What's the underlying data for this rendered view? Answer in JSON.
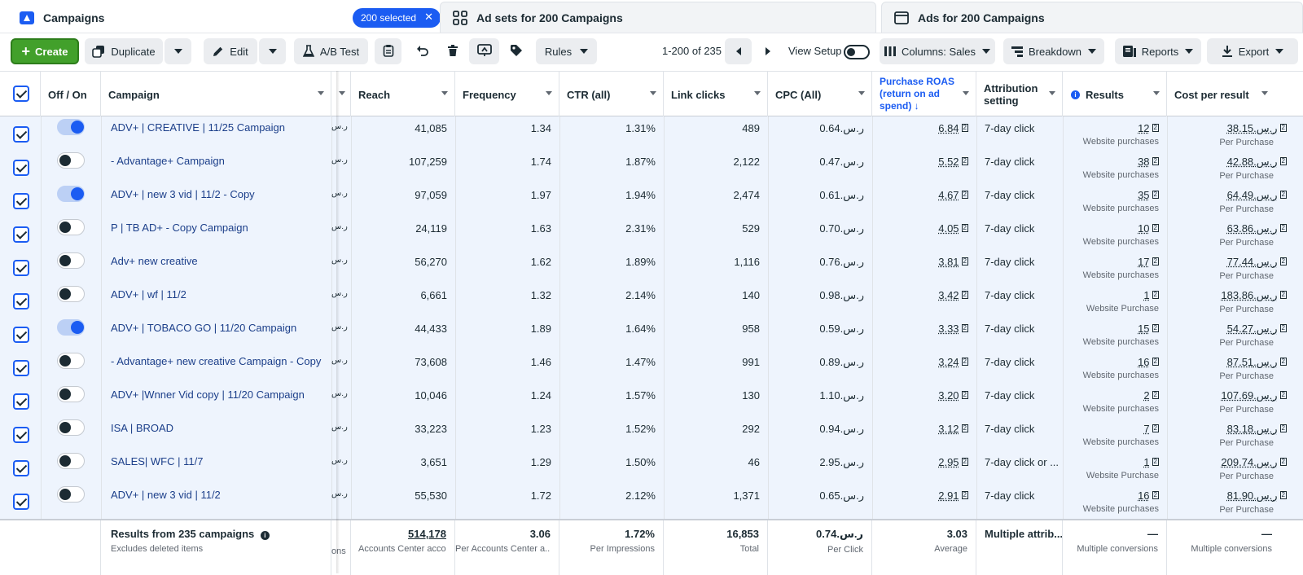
{
  "tabs": {
    "campaigns": {
      "label": "Campaigns",
      "selected_pill": "200 selected"
    },
    "adsets": {
      "label": "Ad sets for 200 Campaigns"
    },
    "ads": {
      "label": "Ads for 200 Campaigns"
    }
  },
  "toolbar": {
    "create": "Create",
    "duplicate": "Duplicate",
    "edit": "Edit",
    "abtest": "A/B Test",
    "rules": "Rules",
    "pager": "1-200 of 235",
    "view_setup": "View Setup",
    "columns": "Columns: Sales",
    "breakdown": "Breakdown",
    "reports": "Reports",
    "export": "Export"
  },
  "columns": {
    "offon": "Off / On",
    "campaign": "Campaign",
    "reach": "Reach",
    "frequency": "Frequency",
    "ctr": "CTR (all)",
    "link_clicks": "Link clicks",
    "cpc": "CPC (All)",
    "roas_1": "Purchase ROAS",
    "roas_2": "(return on ad",
    "roas_3": "spend) ↓",
    "attr_1": "Attribution",
    "attr_2": "setting",
    "results": "Results",
    "cost": "Cost per result"
  },
  "rows": [
    {
      "name": "ADV+ | CREATIVE | 11/25 Campaign",
      "on": true,
      "cur": "ر.س",
      "reach": "41,085",
      "freq": "1.34",
      "ctr": "1.31%",
      "clicks": "489",
      "cpc": "ر.س.0.64",
      "roas": "6.84",
      "attr": "7-day click",
      "results": "12",
      "results_sub": "Website purchases",
      "cost": "ر.س.38.15",
      "cost_sub": "Per Purchase"
    },
    {
      "name": "- Advantage+ Campaign",
      "on": false,
      "cur": "ر.س",
      "reach": "107,259",
      "freq": "1.74",
      "ctr": "1.87%",
      "clicks": "2,122",
      "cpc": "ر.س.0.47",
      "roas": "5.52",
      "attr": "7-day click",
      "results": "38",
      "results_sub": "Website purchases",
      "cost": "ر.س.42.88",
      "cost_sub": "Per Purchase"
    },
    {
      "name": "ADV+ | new 3 vid | 11/2 - Copy",
      "on": true,
      "cur": "ر.س",
      "reach": "97,059",
      "freq": "1.97",
      "ctr": "1.94%",
      "clicks": "2,474",
      "cpc": "ر.س.0.61",
      "roas": "4.67",
      "attr": "7-day click",
      "results": "35",
      "results_sub": "Website purchases",
      "cost": "ر.س.64.49",
      "cost_sub": "Per Purchase"
    },
    {
      "name": "P | TB AD+ - Copy Campaign",
      "on": false,
      "cur": "ر.س",
      "reach": "24,119",
      "freq": "1.63",
      "ctr": "2.31%",
      "clicks": "529",
      "cpc": "ر.س.0.70",
      "roas": "4.05",
      "attr": "7-day click",
      "results": "10",
      "results_sub": "Website purchases",
      "cost": "ر.س.63.86",
      "cost_sub": "Per Purchase"
    },
    {
      "name": "Adv+ new creative",
      "on": false,
      "cur": "ر.س",
      "reach": "56,270",
      "freq": "1.62",
      "ctr": "1.89%",
      "clicks": "1,116",
      "cpc": "ر.س.0.76",
      "roas": "3.81",
      "attr": "7-day click",
      "results": "17",
      "results_sub": "Website purchases",
      "cost": "ر.س.77.44",
      "cost_sub": "Per Purchase"
    },
    {
      "name": "ADV+ | wf | 11/2",
      "on": false,
      "cur": "ر.س",
      "reach": "6,661",
      "freq": "1.32",
      "ctr": "2.14%",
      "clicks": "140",
      "cpc": "ر.س.0.98",
      "roas": "3.42",
      "attr": "7-day click",
      "results": "1",
      "results_sub": "Website Purchase",
      "cost": "ر.س.183.86",
      "cost_sub": "Per Purchase"
    },
    {
      "name": "ADV+ | TOBACO GO | 11/20 Campaign",
      "on": true,
      "cur": "ر.س",
      "reach": "44,433",
      "freq": "1.89",
      "ctr": "1.64%",
      "clicks": "958",
      "cpc": "ر.س.0.59",
      "roas": "3.33",
      "attr": "7-day click",
      "results": "15",
      "results_sub": "Website purchases",
      "cost": "ر.س.54.27",
      "cost_sub": "Per Purchase"
    },
    {
      "name": "- Advantage+ new creative Campaign - Copy",
      "on": false,
      "cur": "ر.س",
      "reach": "73,608",
      "freq": "1.46",
      "ctr": "1.47%",
      "clicks": "991",
      "cpc": "ر.س.0.89",
      "roas": "3.24",
      "attr": "7-day click",
      "results": "16",
      "results_sub": "Website purchases",
      "cost": "ر.س.87.51",
      "cost_sub": "Per Purchase"
    },
    {
      "name": "ADV+ |Wnner Vid copy | 11/20 Campaign",
      "on": false,
      "cur": "ر.س",
      "reach": "10,046",
      "freq": "1.24",
      "ctr": "1.57%",
      "clicks": "130",
      "cpc": "ر.س.1.10",
      "roas": "3.20",
      "attr": "7-day click",
      "results": "2",
      "results_sub": "Website purchases",
      "cost": "ر.س.107.69",
      "cost_sub": "Per Purchase"
    },
    {
      "name": "ISA | BROAD",
      "on": false,
      "cur": "ر.س",
      "reach": "33,223",
      "freq": "1.23",
      "ctr": "1.52%",
      "clicks": "292",
      "cpc": "ر.س.0.94",
      "roas": "3.12",
      "attr": "7-day click",
      "results": "7",
      "results_sub": "Website purchases",
      "cost": "ر.س.83.18",
      "cost_sub": "Per Purchase"
    },
    {
      "name": "SALES| WFC | 11/7",
      "on": false,
      "cur": "ر.س",
      "reach": "3,651",
      "freq": "1.29",
      "ctr": "1.50%",
      "clicks": "46",
      "cpc": "ر.س.2.95",
      "roas": "2.95",
      "attr": "7-day click or ...",
      "results": "1",
      "results_sub": "Website Purchase",
      "cost": "ر.س.209.74",
      "cost_sub": "Per Purchase"
    },
    {
      "name": "ADV+ | new 3 vid | 11/2",
      "on": false,
      "cur": "ر.س",
      "reach": "55,530",
      "freq": "1.72",
      "ctr": "2.12%",
      "clicks": "1,371",
      "cpc": "ر.س.0.65",
      "roas": "2.91",
      "attr": "7-day click",
      "results": "16",
      "results_sub": "Website purchases",
      "cost": "ر.س.81.90",
      "cost_sub": "Per Purchase"
    }
  ],
  "footer": {
    "title": "Results from 235 campaigns",
    "title_sub": "Excludes deleted items",
    "cur_sub": "ons",
    "reach": "514,178",
    "reach_sub": "Accounts Center acco...",
    "freq": "3.06",
    "freq_sub": "Per Accounts Center a...",
    "ctr": "1.72%",
    "ctr_sub": "Per Impressions",
    "clicks": "16,853",
    "clicks_sub": "Total",
    "cpc": "ر.س.0.74",
    "cpc_sub": "Per Click",
    "roas": "3.03",
    "roas_sub": "Average",
    "attr": "Multiple attrib...",
    "results": "—",
    "results_sub": "Multiple conversions",
    "cost": "—",
    "cost_sub": "Multiple conversions"
  }
}
